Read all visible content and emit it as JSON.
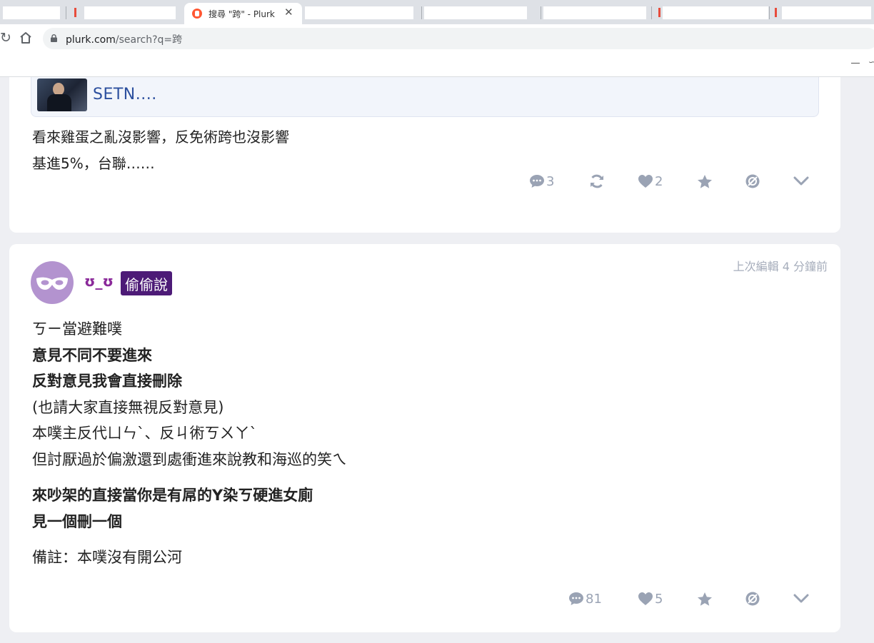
{
  "browser": {
    "active_tab_title": "搜尋 \"跨\" - Plurk",
    "tab_close_glyph": "✕",
    "url_host": "plurk.com",
    "url_path": "/search?q=跨"
  },
  "post1": {
    "preview_title": "SETN....",
    "lines": [
      "看來雞蛋之亂沒影響，反免術跨也沒影響",
      "基進5%，台聯……"
    ],
    "actions": {
      "responses": "3",
      "likes": "2"
    }
  },
  "post2": {
    "username": "ʊ_ʊ",
    "whisper_label": "偷偷說",
    "edited_time": "上次編輯 4 分鐘前",
    "lines": [
      {
        "text": "ㄎㄧ當避難噗",
        "bold": false
      },
      {
        "text": "意見不同不要進來",
        "bold": true
      },
      {
        "text": "反對意見我會直接刪除",
        "bold": true
      },
      {
        "text": "(也請大家直接無視反對意見)",
        "bold": false
      },
      {
        "text": "本噗主反代ㄩㄣˋ、反ㄐ術ㄎㄨㄚˋ",
        "bold": false
      },
      {
        "text": "但討厭過於偏激還到處衝進來說教和海巡的笑ㄟ",
        "bold": false
      }
    ],
    "lines_b": [
      {
        "text": "來吵架的直接當你是有屌的Y染ㄎ硬進女廁",
        "bold": true
      },
      {
        "text": "見一個刪一個",
        "bold": true
      }
    ],
    "note": "備註：本噗沒有開公河",
    "actions": {
      "responses": "81",
      "likes": "5"
    }
  },
  "colors": {
    "icon_gray": "#9aa3b4",
    "username": "#8b2a9a",
    "whisper_bg": "#4d1b77",
    "link": "#2c4f9e"
  }
}
